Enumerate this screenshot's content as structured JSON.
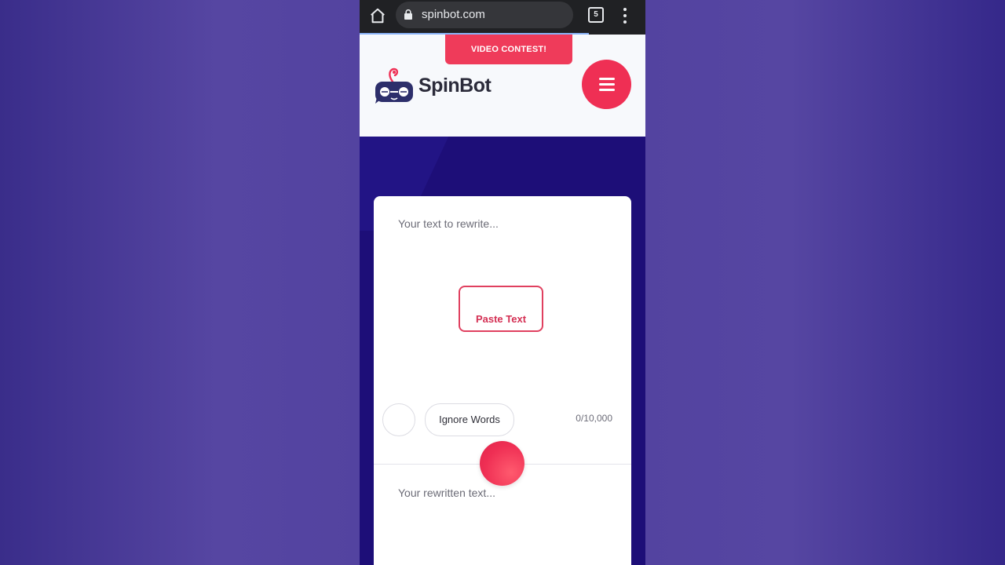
{
  "browser": {
    "url": "spinbot.com",
    "tab_count": "5"
  },
  "header": {
    "contest_label": "VIDEO CONTEST!",
    "logo_text": "SpinBot"
  },
  "editor": {
    "input_placeholder": "Your text to rewrite...",
    "paste_button": "Paste Text",
    "ignore_words_button": "Ignore Words",
    "char_counter": "0/10,000",
    "output_placeholder": "Your rewritten text..."
  },
  "colors": {
    "accent": "#ef2f54",
    "hero_bg": "#1d0e78",
    "page_bg": "#4d3f9c"
  }
}
